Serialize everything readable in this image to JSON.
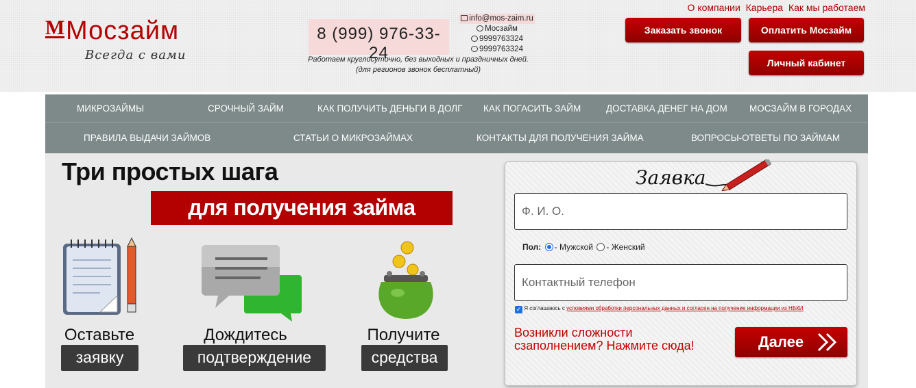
{
  "header": {
    "logo_mark": "М",
    "logo_name": "Мосзайм",
    "slogan": "Всегда с вами",
    "phone": "8 (999) 976-33-24",
    "work_hours_line1": "Работаем круглосуточно, без выходных и праздничных дней.",
    "work_hours_line2": "(для регионов звонок бесплатный)",
    "email": "info@mos-zaim.ru",
    "skype": "Мосзайм",
    "viber": "9999763324",
    "whatsapp": "9999763324",
    "toplinks": [
      "О компании",
      "Карьера",
      "Как мы работаем"
    ],
    "btn_call": "Заказать звонок",
    "btn_pay": "Оплатить Мосзайм",
    "btn_cabinet": "Личный кабинет"
  },
  "nav": {
    "row1": [
      "Микрозаймы",
      "Срочный займ",
      "Как получить деньги в долг",
      "Как погасить займ",
      "Доставка денег на дом",
      "Мосзайм в городах"
    ],
    "row2": [
      "Правила выдачи займов",
      "Статьи о микрозаймах",
      "Контакты для получения займа",
      "Вопросы-ответы по займам"
    ]
  },
  "steps": {
    "title": "Три простых шага",
    "banner": "для получения займа",
    "items": [
      {
        "caption": "Оставьте",
        "badge": "заявку"
      },
      {
        "caption": "Дождитесь",
        "badge": "подтверждение"
      },
      {
        "caption": "Получите",
        "badge": "средства"
      }
    ]
  },
  "form": {
    "title": "Заявка",
    "name_placeholder": "Ф. И. О.",
    "gender_label": "Пол:",
    "gender_male": "- Мужской",
    "gender_female": "- Женский",
    "phone_placeholder": "Контактный телефон",
    "consent_prefix": "Я соглашаюсь с ",
    "consent_link": "условиями обработки персональных данных и согласен на получение информации из НБКИ",
    "help_text": "Возникли сложности сзаполнением? Нажмите сюда!",
    "submit": "Далее"
  },
  "colors": {
    "brand_red": "#b30000",
    "nav_bg": "#7d8a89",
    "accent_blue": "#1e6ee6"
  }
}
